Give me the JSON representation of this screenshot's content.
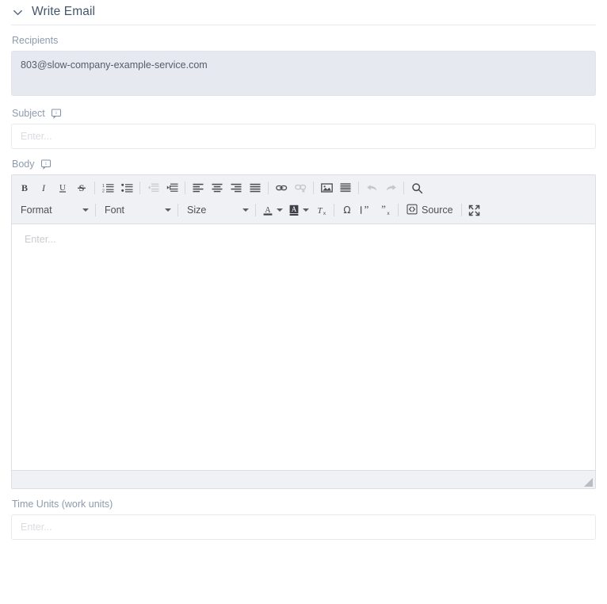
{
  "panel": {
    "title": "Write Email",
    "collapse_icon": "chevron-down-icon"
  },
  "fields": {
    "recipients": {
      "label": "Recipients",
      "value": "803@slow-company-example-service.com"
    },
    "subject": {
      "label": "Subject",
      "value": "",
      "placeholder": "Enter...",
      "info_icon": "info-tooltip-icon"
    },
    "body": {
      "label": "Body",
      "placeholder": "Enter...",
      "info_icon": "info-tooltip-icon"
    },
    "time_units": {
      "label": "Time Units (work units)",
      "value": "",
      "placeholder": "Enter..."
    }
  },
  "editor": {
    "toolbar_row1": [
      {
        "name": "bold",
        "icon": "bold-icon",
        "disabled": false
      },
      {
        "name": "italic",
        "icon": "italic-icon",
        "disabled": false
      },
      {
        "name": "underline",
        "icon": "underline-icon",
        "disabled": false
      },
      {
        "name": "strikethrough",
        "icon": "strikethrough-icon",
        "disabled": false
      },
      {
        "name": "separator",
        "icon": "separator",
        "disabled": false
      },
      {
        "name": "numbered-list",
        "icon": "numbered-list-icon",
        "disabled": false
      },
      {
        "name": "bulleted-list",
        "icon": "bulleted-list-icon",
        "disabled": false
      },
      {
        "name": "separator",
        "icon": "separator",
        "disabled": false
      },
      {
        "name": "decrease-indent",
        "icon": "outdent-icon",
        "disabled": true
      },
      {
        "name": "increase-indent",
        "icon": "indent-icon",
        "disabled": false
      },
      {
        "name": "separator",
        "icon": "separator",
        "disabled": false
      },
      {
        "name": "align-left",
        "icon": "align-left-icon",
        "disabled": false
      },
      {
        "name": "align-center",
        "icon": "align-center-icon",
        "disabled": false
      },
      {
        "name": "align-right",
        "icon": "align-right-icon",
        "disabled": false
      },
      {
        "name": "align-justify",
        "icon": "align-justify-icon",
        "disabled": false
      },
      {
        "name": "separator",
        "icon": "separator",
        "disabled": false
      },
      {
        "name": "insert-link",
        "icon": "link-icon",
        "disabled": false
      },
      {
        "name": "remove-link",
        "icon": "unlink-icon",
        "disabled": true
      },
      {
        "name": "separator",
        "icon": "separator",
        "disabled": false
      },
      {
        "name": "insert-image",
        "icon": "image-icon",
        "disabled": false
      },
      {
        "name": "horizontal-rule",
        "icon": "horizontal-rule-icon",
        "disabled": false
      },
      {
        "name": "separator",
        "icon": "separator",
        "disabled": false
      },
      {
        "name": "undo",
        "icon": "undo-icon",
        "disabled": true
      },
      {
        "name": "redo",
        "icon": "redo-icon",
        "disabled": true
      },
      {
        "name": "separator",
        "icon": "separator",
        "disabled": false
      },
      {
        "name": "find",
        "icon": "search-icon",
        "disabled": false
      }
    ],
    "dropdowns": {
      "format": "Format",
      "font": "Font",
      "size": "Size"
    },
    "toolbar_row2": [
      {
        "name": "text-color",
        "icon": "text-color-icon"
      },
      {
        "name": "background-color",
        "icon": "background-color-icon"
      },
      {
        "name": "remove-format",
        "icon": "remove-format-icon"
      },
      {
        "name": "special-character",
        "icon": "omega-icon"
      },
      {
        "name": "insert-citation",
        "icon": "quote-insert-icon"
      },
      {
        "name": "remove-citation",
        "icon": "quote-remove-icon"
      }
    ],
    "source_label": "Source",
    "source_icon": "source-code-icon",
    "maximize_icon": "maximize-icon",
    "resize_grip_icon": "resize-grip-icon"
  },
  "colors": {
    "toolbar_bg": "#f0f1f5",
    "label_text": "#8d9bad",
    "title_text": "#41566c",
    "readonly_field_bg": "#e6e9ef",
    "border": "#dcdee3",
    "placeholder": "#d9dce1"
  }
}
